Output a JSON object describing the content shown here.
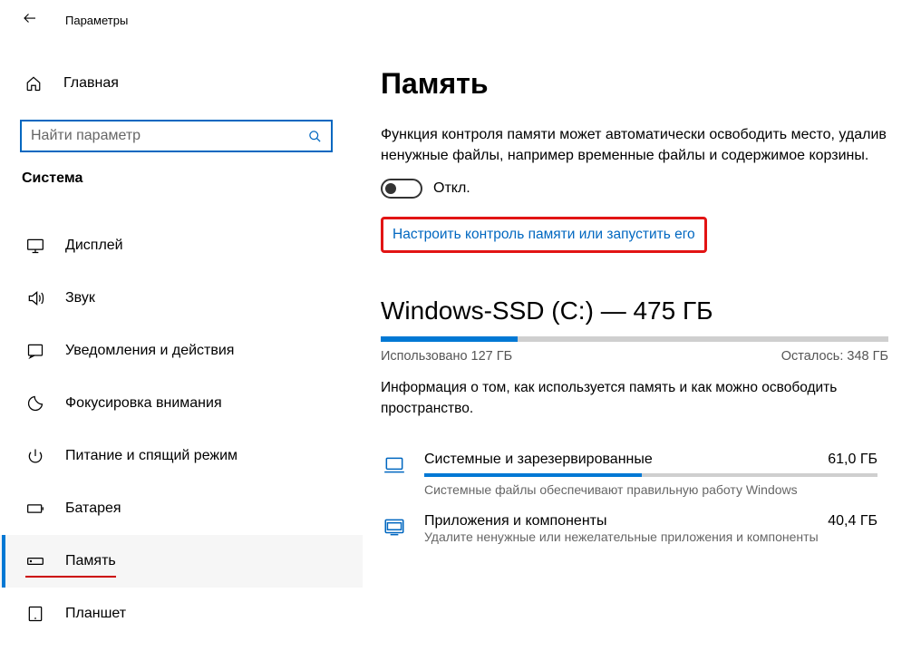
{
  "header": {
    "title": "Параметры"
  },
  "sidebar": {
    "home": "Главная",
    "search_placeholder": "Найти параметр",
    "category": "Система",
    "items": [
      {
        "icon": "display",
        "label": "Дисплей"
      },
      {
        "icon": "sound",
        "label": "Звук"
      },
      {
        "icon": "notify",
        "label": "Уведомления и действия"
      },
      {
        "icon": "focus",
        "label": "Фокусировка внимания"
      },
      {
        "icon": "power",
        "label": "Питание и спящий режим"
      },
      {
        "icon": "battery",
        "label": "Батарея"
      },
      {
        "icon": "storage",
        "label": "Память",
        "selected": true,
        "underline_red": true
      },
      {
        "icon": "tablet",
        "label": "Планшет"
      }
    ]
  },
  "main": {
    "title": "Память",
    "storage_sense_desc": "Функция контроля памяти может автоматически освободить место, удалив ненужные файлы, например временные файлы и содержимое корзины.",
    "toggle_state": "Откл.",
    "config_link": "Настроить контроль памяти или запустить его",
    "drive": {
      "title": "Windows-SSD (C:) — 475 ГБ",
      "used_label": "Использовано 127 ГБ",
      "free_label": "Осталось: 348 ГБ",
      "fill_percent": 27,
      "info": "Информация о том, как используется память и как можно освободить пространство."
    },
    "categories": [
      {
        "icon": "laptop",
        "name": "Системные и зарезервированные",
        "size": "61,0 ГБ",
        "fill_percent": 48,
        "sub": "Системные файлы обеспечивают правильную работу Windows"
      },
      {
        "icon": "apps",
        "name": "Приложения и компоненты",
        "size": "40,4 ГБ",
        "sub": "Удалите ненужные или нежелательные приложения и компоненты"
      }
    ]
  }
}
